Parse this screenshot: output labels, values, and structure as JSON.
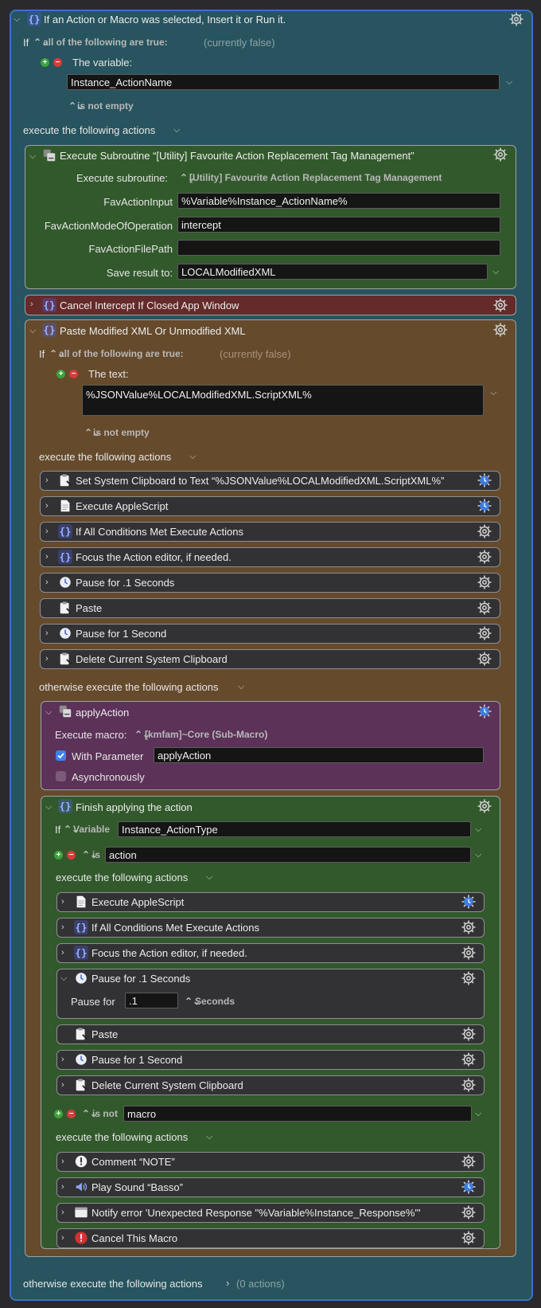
{
  "main": {
    "title": "If an Action or Macro was selected, Insert it or Run it.",
    "if_label": "If",
    "condition_mode": "all of the following are true:",
    "currently": "(currently false)",
    "variable_label": "The variable:",
    "variable_value": "Instance_ActionName",
    "variable_test": "is not empty",
    "execute_label": "execute the following actions",
    "otherwise_label": "otherwise execute the following actions",
    "otherwise_count": "(0 actions)"
  },
  "subroutine": {
    "title": "Execute Subroutine “[Utility] Favourite Action Replacement Tag Management”",
    "exec_label": "Execute subroutine:",
    "exec_value": "[Utility] Favourite Action Replacement Tag Management",
    "params": [
      {
        "label": "FavActionInput",
        "value": "%Variable%Instance_ActionName%"
      },
      {
        "label": "FavActionModeOfOperation",
        "value": "intercept"
      },
      {
        "label": "FavActionFilePath",
        "value": ""
      }
    ],
    "save_label": "Save result to:",
    "save_value": "LOCALModifiedXML"
  },
  "cancel_intercept": {
    "title": "Cancel Intercept If Closed App Window"
  },
  "paste_group": {
    "title": "Paste Modified XML Or Unmodified XML",
    "if_label": "If",
    "condition_mode": "all of the following are true:",
    "currently": "(currently false)",
    "text_label": "The text:",
    "text_value": "%JSONValue%LOCALModifiedXML.ScriptXML%",
    "text_test": "is not empty",
    "execute_label": "execute the following actions",
    "actions": [
      {
        "title": "Set System Clipboard to Text “%JSONValue%LOCALModifiedXML.ScriptXML%”"
      },
      {
        "title": "Execute AppleScript"
      },
      {
        "title": "If All Conditions Met Execute Actions"
      },
      {
        "title": "Focus the Action editor, if needed."
      },
      {
        "title": "Pause for .1 Seconds"
      },
      {
        "title": "Paste"
      },
      {
        "title": "Pause for 1 Second"
      },
      {
        "title": "Delete Current System Clipboard"
      }
    ],
    "otherwise_label": "otherwise execute the following actions"
  },
  "apply_action": {
    "title": "applyAction",
    "exec_label": "Execute macro:",
    "exec_value": "[kmfam]~Core (Sub-Macro)",
    "param_label": "With Parameter",
    "param_value": "applyAction",
    "async_label": "Asynchronously"
  },
  "finish": {
    "title": "Finish applying the action",
    "if_label": "If",
    "var_mode": "Variable",
    "var_value": "Instance_ActionType",
    "is_label": "is",
    "is_value": "action",
    "execute_label": "execute the following actions",
    "actions": [
      {
        "title": "Execute AppleScript"
      },
      {
        "title": "If All Conditions Met Execute Actions"
      },
      {
        "title": "Focus the Action editor, if needed."
      },
      {
        "title": "Pause for .1 Seconds"
      },
      {
        "title": "Paste"
      },
      {
        "title": "Pause for 1 Second"
      },
      {
        "title": "Delete Current System Clipboard"
      }
    ],
    "pause_label": "Pause for",
    "pause_value": ".1",
    "pause_unit": "Seconds",
    "isnot_label": "is not",
    "isnot_value": "macro",
    "execute2_label": "execute the following actions",
    "actions2": [
      {
        "title": "Comment “NOTE”"
      },
      {
        "title": "Play Sound “Basso”"
      },
      {
        "title": "Notify error 'Unexpected Response \"%Variable%Instance_Response%\"'"
      },
      {
        "title": "Cancel This Macro"
      }
    ]
  },
  "colors": {
    "outer": "#27545e",
    "green": "#32592c",
    "red": "#652a2a",
    "brown": "#654a2c",
    "purple": "#5c3259",
    "dark": "#323234",
    "accent": "#3a72c4"
  }
}
